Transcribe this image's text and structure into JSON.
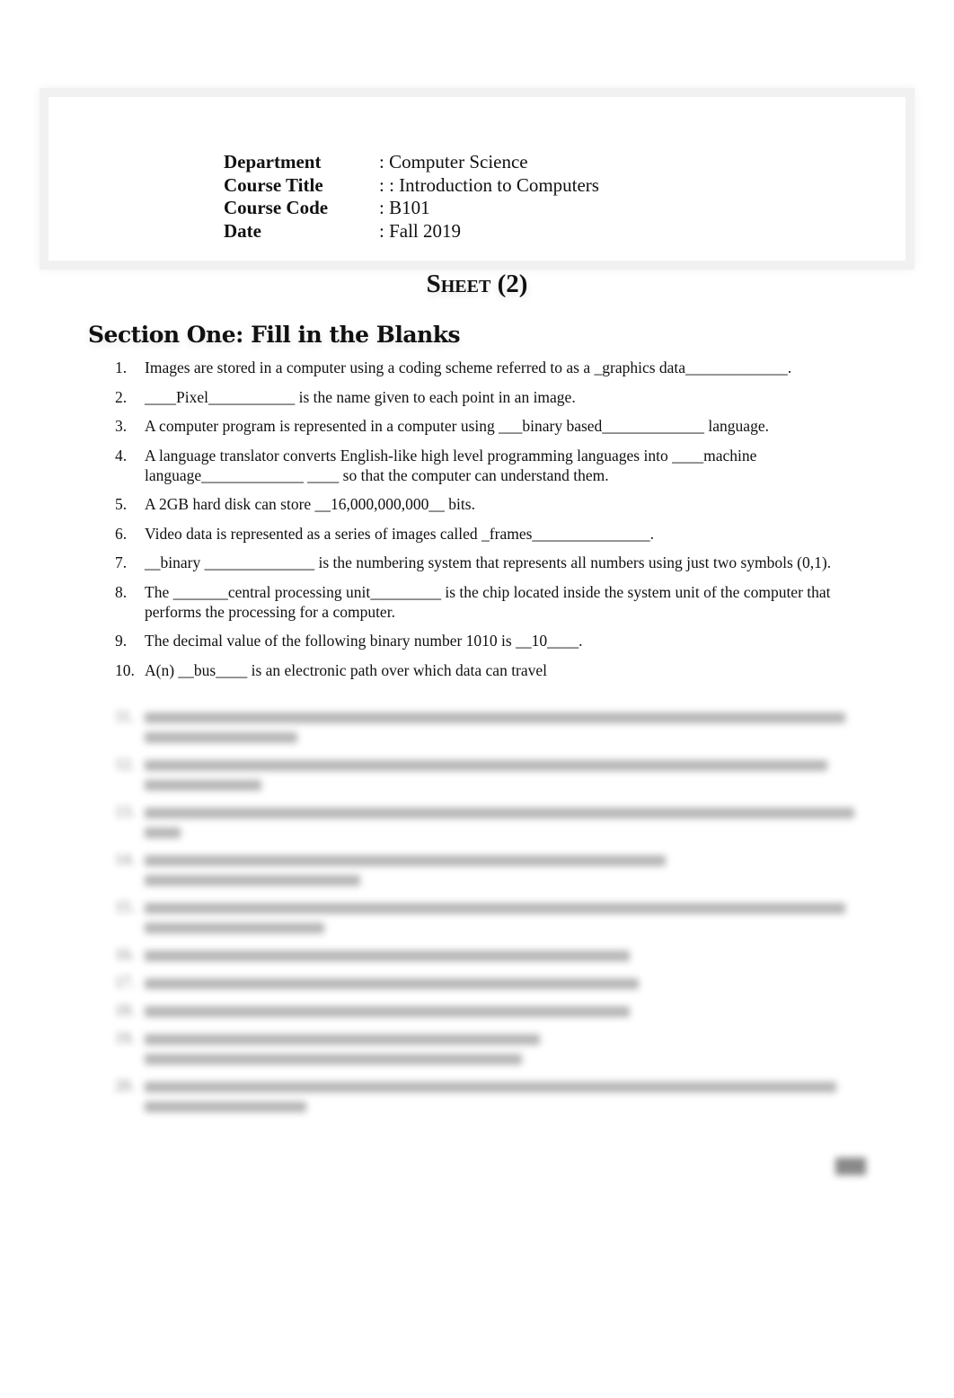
{
  "header": {
    "rows": [
      {
        "label": "Department",
        "value": ": Computer Science"
      },
      {
        "label": "Course Title",
        "value": ": : Introduction to Computers"
      },
      {
        "label": "Course Code",
        "value": ": B101"
      },
      {
        "label": "Date",
        "value": ": Fall 2019"
      }
    ]
  },
  "sheet_title": "Sheet (2)",
  "section": {
    "heading": "Section One: Fill in the Blanks",
    "questions": [
      {
        "num": "1.",
        "text": "Images are stored in a computer using a coding scheme referred to as a _graphics data_____________."
      },
      {
        "num": "2.",
        "text": "____Pixel___________ is the name given to each point in an image."
      },
      {
        "num": "3.",
        "text": "A computer program is represented in a computer using ___binary based_____________ language."
      },
      {
        "num": "4.",
        "text": "A language translator converts English-like high level programming languages into ____machine language_____________ ____ so that the computer can understand them."
      },
      {
        "num": "5.",
        "text": "A 2GB hard disk can store __16,000,000,000__ bits."
      },
      {
        "num": "6.",
        "text": "Video data is represented as a series of images called _frames_______________."
      },
      {
        "num": "7.",
        "text": "__binary ______________ is the numbering system that represents all numbers using just two symbols (0,1)."
      },
      {
        "num": "8.",
        "text": "The _______central processing unit_________ is the chip located inside the system unit of the computer that performs the processing for a computer."
      },
      {
        "num": "9.",
        "text": "The decimal value of the following binary number 1010 is __10____."
      },
      {
        "num": "10.",
        "text": "A(n) __bus____  is an electronic path over which data can travel"
      }
    ],
    "blurred_questions": [
      "11.",
      "12.",
      "13.",
      "14.",
      "15.",
      "16.",
      "17.",
      "18.",
      "19.",
      "20."
    ]
  }
}
